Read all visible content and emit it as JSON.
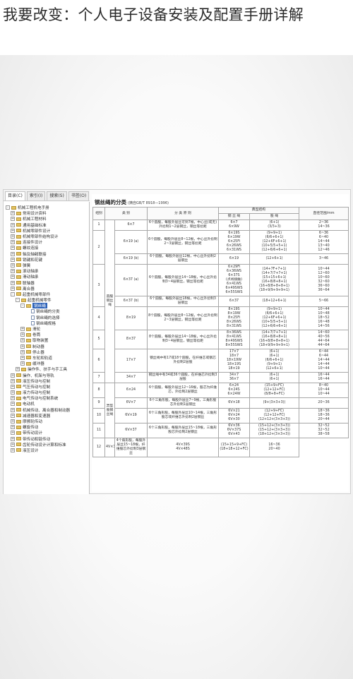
{
  "page": {
    "title": "我要改变：个人电子设备安装及配置手册详解"
  },
  "tabs": [
    "目录(C)",
    "索引(I)",
    "搜索(S)",
    "书签(O)"
  ],
  "tree": [
    {
      "toggle": "-",
      "type": "folder",
      "indent": 0,
      "label": "机械工程机电手册"
    },
    {
      "toggle": "+",
      "type": "folder",
      "indent": 1,
      "label": "常用设计资料"
    },
    {
      "toggle": "+",
      "type": "folder",
      "indent": 1,
      "label": "机械工程材料"
    },
    {
      "toggle": "+",
      "type": "folder",
      "indent": 1,
      "label": "通用基础标准"
    },
    {
      "toggle": "+",
      "type": "folder",
      "indent": 1,
      "label": "机械零部件设计"
    },
    {
      "toggle": "+",
      "type": "folder",
      "indent": 1,
      "label": "机械零部件结构设计"
    },
    {
      "toggle": "+",
      "type": "folder",
      "indent": 1,
      "label": "连接件设计"
    },
    {
      "toggle": "+",
      "type": "folder",
      "indent": 1,
      "label": "螺纹连接"
    },
    {
      "toggle": "+",
      "type": "folder",
      "indent": 1,
      "label": "轴及轴毂联接"
    },
    {
      "toggle": "+",
      "type": "folder",
      "indent": 1,
      "label": "销键和花键"
    },
    {
      "toggle": "+",
      "type": "folder",
      "indent": 1,
      "label": "弹簧"
    },
    {
      "toggle": "+",
      "type": "folder",
      "indent": 1,
      "label": "滚动轴承"
    },
    {
      "toggle": "+",
      "type": "folder",
      "indent": 1,
      "label": "滑动轴承"
    },
    {
      "toggle": "+",
      "type": "folder",
      "indent": 1,
      "label": "联轴器"
    },
    {
      "toggle": "+",
      "type": "folder",
      "indent": 1,
      "label": "离合器"
    },
    {
      "toggle": "-",
      "type": "folder",
      "indent": 1,
      "label": "起重机械零部件"
    },
    {
      "toggle": "-",
      "type": "folder",
      "indent": 2,
      "label": "起重机械零件"
    },
    {
      "toggle": "-",
      "type": "folder",
      "indent": 3,
      "label": "钢丝绳",
      "selected": true
    },
    {
      "toggle": "",
      "type": "doc",
      "indent": 4,
      "label": "钢丝绳的分类"
    },
    {
      "toggle": "",
      "type": "doc",
      "indent": 4,
      "label": "钢丝绳的选择"
    },
    {
      "toggle": "",
      "type": "doc",
      "indent": 4,
      "label": "钢丝绳规格"
    },
    {
      "toggle": "+",
      "type": "folder",
      "indent": 3,
      "label": "滑轮"
    },
    {
      "toggle": "+",
      "type": "folder",
      "indent": 3,
      "label": "卷筒"
    },
    {
      "toggle": "+",
      "type": "folder",
      "indent": 3,
      "label": "取物装置"
    },
    {
      "toggle": "+",
      "type": "folder",
      "indent": 3,
      "label": "制动器"
    },
    {
      "toggle": "+",
      "type": "folder",
      "indent": 3,
      "label": "停止器"
    },
    {
      "toggle": "+",
      "type": "folder",
      "indent": 3,
      "label": "车轮和轨道"
    },
    {
      "toggle": "+",
      "type": "folder",
      "indent": 3,
      "label": "缓冲器"
    },
    {
      "toggle": "+",
      "type": "folder",
      "indent": 2,
      "label": "操作件、扶手与手工具"
    },
    {
      "toggle": "+",
      "type": "folder",
      "indent": 1,
      "label": "操作、机架与导轨"
    },
    {
      "toggle": "+",
      "type": "folder",
      "indent": 1,
      "label": "液压传动与控制"
    },
    {
      "toggle": "+",
      "type": "folder",
      "indent": 1,
      "label": "气压传动与控制"
    },
    {
      "toggle": "+",
      "type": "folder",
      "indent": 1,
      "label": "液力传动与控制"
    },
    {
      "toggle": "+",
      "type": "folder",
      "indent": 1,
      "label": "电气传动与控制系统"
    },
    {
      "toggle": "+",
      "type": "folder",
      "indent": 1,
      "label": "电动机"
    },
    {
      "toggle": "+",
      "type": "folder",
      "indent": 1,
      "label": "机械传动、离合器和制动器"
    },
    {
      "toggle": "+",
      "type": "folder",
      "indent": 1,
      "label": "减速器和变速器"
    },
    {
      "toggle": "+",
      "type": "folder",
      "indent": 1,
      "label": "摩擦轮传动"
    },
    {
      "toggle": "+",
      "type": "folder",
      "indent": 1,
      "label": "螺旋传动"
    },
    {
      "toggle": "+",
      "type": "folder",
      "indent": 1,
      "label": "带传动设计"
    },
    {
      "toggle": "+",
      "type": "folder",
      "indent": 1,
      "label": "带传动和链传动"
    },
    {
      "toggle": "+",
      "type": "folder",
      "indent": 1,
      "label": "齿轮传动设计计算和标准"
    },
    {
      "toggle": "+",
      "type": "folder",
      "indent": 1,
      "label": "液压设计"
    }
  ],
  "document": {
    "title": "钢丝绳的分类",
    "standard": "(摘自GB/T 8918—1996)",
    "headers": {
      "group": "组别",
      "category": "类 别",
      "principle": "分 类 原 则",
      "typical_structure": "典型结构",
      "wire_rope": "钢 丝 绳",
      "strand": "股 绳",
      "diameter": "直径范围/mm"
    },
    "categories": [
      {
        "name": "圆股钢丝绳",
        "rowspan": 9
      },
      {
        "name": "异型股钢丝绳",
        "rowspan": 4
      }
    ],
    "rows": [
      {
        "group": "1",
        "category": "6×7",
        "principle": "6个圆股，每股外层丝可到7根，中心丝(或无)外捻制1~2层钢丝，钢丝等捻距",
        "rope": "6×7\n6×9W",
        "strand": "(6+1)\n(3/3+3)",
        "diameter": "2~36\n14~36"
      },
      {
        "group": "2",
        "category": "6×19 (a)",
        "principle": "6个圆股，每股外层丝8~12根，中心丝外捻制2~3层钢丝，钢丝等捻距",
        "rope": "6×19S\n6×19W\n6×25Fi\n6×26WS\n6×31WS",
        "strand": "(9+9+1)\n(6/6+6+1)\n(12+6F+6+1)\n(10+5/5+5+1)\n(12+6/6+6+1)",
        "diameter": "6~36\n6~40\n14~44\n13~40\n12~46"
      },
      {
        "group": "",
        "category": "6×19 (b)",
        "principle": "6个圆股，每股外层丝12根，中心丝外捻制2层钢丝",
        "rope": "6×19",
        "strand": "(12+6+1)",
        "diameter": "3~46"
      },
      {
        "group": "3",
        "category": "6×37 (a)",
        "principle": "6个圆股，每股外层丝14~18根，中心丝外捻制3~4层钢丝，钢丝等捻距",
        "rope": "6×29Fi\n6×36WS\n6×37S\n(点线接触)\n6×41WS\n6×49SWS\n6×55SWS",
        "strand": "(14+7F+7+1)\n(14+7/7+7+1)\n(15+15+6+1)\n(16+8/8+8+1)\n(16+8/8+8+8+1)\n(18+9/9+9+9+1)",
        "diameter": "10~44\n12~60\n10~60\n32~60\n36~60\n36~64"
      },
      {
        "group": "",
        "category": "6×37 (b)",
        "principle": "6个圆股，每股外层丝18根，中心丝外捻制3层钢丝",
        "rope": "6×37",
        "strand": "(18+12+6+1)",
        "diameter": "5~66"
      },
      {
        "group": "4",
        "category": "8×19",
        "principle": "8个圆股，每股外层丝8~12根，中心丝外捻制2~3层钢丝，钢丝等捻距",
        "rope": "8×19S\n8×19W\n8×25Fi\n8×26WS\n8×31WS",
        "strand": "(9+9+1)\n(6/6+6+1)\n(12+6F+6+1)\n(10+5/5+5+1)\n(12+6/6+6+1)",
        "diameter": "10~44\n10~48\n18~52\n16~48\n14~56"
      },
      {
        "group": "5",
        "category": "8×37",
        "principle": "8个圆股，每股外层丝14~18根，中心丝外捻制3~4层钢丝，钢丝等捻距",
        "rope": "8×36WS\n8×41WS\n8×49SWS\n8×55SWS",
        "strand": "(14+7/7+7+1)\n(16+8/8+8+1)\n(16+8/8+8+8+1)\n(18+9/9+9+9+1)",
        "diameter": "14~60\n40~56\n44~64\n44~64"
      },
      {
        "group": "6",
        "category": "17×7",
        "principle": "钢丝绳中有17或18个圆股，在纤维芯或钢芯外捻制2层股",
        "rope": "17×7\n18×7\n18×19W\n18×19S\n18×19",
        "strand": "(6+1)\n(6+1)\n(6/6+6+1)\n(9+9+1)\n(12+6+1)",
        "diameter": "6~44\n6~44\n14~44\n14~44\n10~44"
      },
      {
        "group": "7",
        "category": "34×7",
        "principle": "钢丝绳中有34或36个圆股，在纤维芯外捻制3层股",
        "rope": "34×7\n36×7",
        "strand": "(6+1)\n(6+1)",
        "diameter": "16~44\n16~44"
      },
      {
        "group": "8",
        "category": "6×24",
        "principle": "6个圆股，每股外层丝12~16根，股芯为纤维芯，外捻制2层钢丝",
        "rope": "6×24\n6×24S\n6×24W",
        "strand": "(15+9+FC)\n(12+12+FC)\n(8/8+8+FC)",
        "diameter": "8~40\n10~44\n10~44"
      },
      {
        "group": "9",
        "category": "6V×7",
        "principle": "6个三角形股，每股外层丝7~9根，三角形股芯外捻制1层钢丝",
        "rope": "6V×18",
        "strand": "(9+(3×3+3))",
        "diameter": "20~36"
      },
      {
        "group": "10",
        "category": "6V×19",
        "principle": "6个三角形股，每股外层丝10~14根，三角形股芯或纤维芯外捻制2层钢丝",
        "rope": "6V×21\n6V×24\n6V×30",
        "strand": "(12+9+FC)\n(12+12+FC)\n(12+12+(3×3+3))",
        "diameter": "18~36\n18~36\n20~44"
      },
      {
        "group": "11",
        "category": "6V×37",
        "principle": "6个三角形股，每股外层丝15~18根，三角形股芯外捻制2层钢丝",
        "rope": "6V×36\n6V×37S\n6V×43",
        "strand": "(15+12+(3×3+3))\n(15+12+(3×3+3))\n(18+12+(3×3+3))",
        "diameter": "32~52\n32~52\n38~58"
      },
      {
        "group": "12",
        "category": "4V×39",
        "principle": "4个扇形股，每股外层丝15~18根，纤维股芯外捻制3层钢丝",
        "rope": "4V×39S\n4V×48S",
        "strand": "(15+15+9+FC)\n(18+18+12+FC)",
        "diameter": "16~36\n20~40"
      }
    ]
  }
}
